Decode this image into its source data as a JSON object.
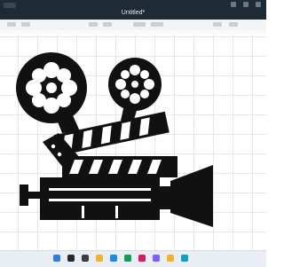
{
  "window": {
    "title": "Untitled*"
  },
  "canvas": {
    "graphic": "movie-camera-clapperboard-silhouette"
  },
  "taskbar": {
    "icons": [
      "windows-start-icon",
      "search-icon",
      "task-view-icon",
      "file-explorer-icon",
      "browser-icon",
      "store-icon",
      "chat-icon",
      "app-icon",
      "cricut-icon",
      "settings-icon"
    ]
  },
  "colors": {
    "titlebar": "#1e2a36",
    "grid": "#e4e7eb",
    "art": "#111111"
  }
}
